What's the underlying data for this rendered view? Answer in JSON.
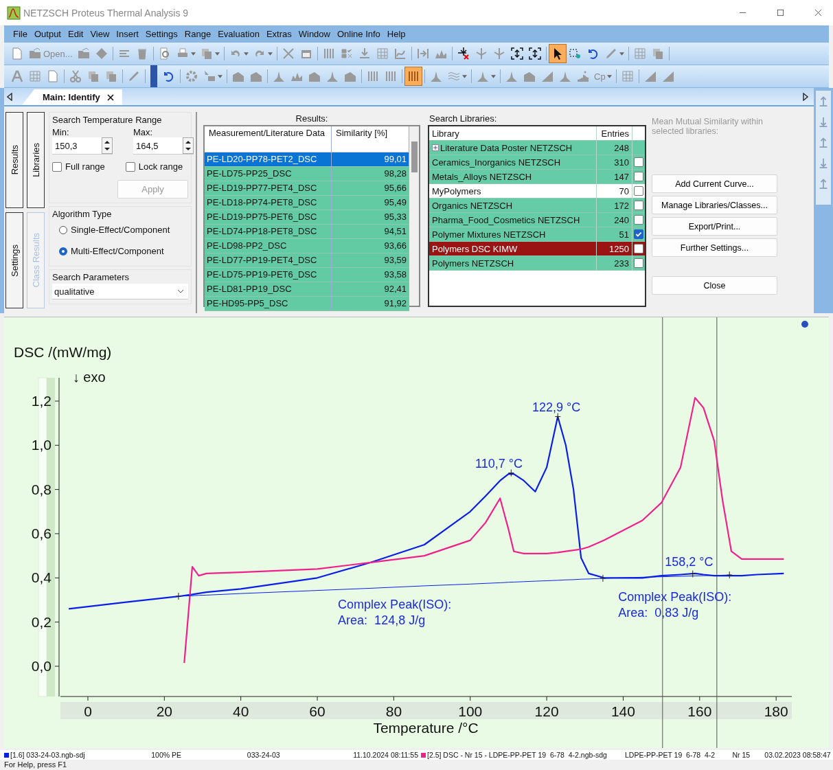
{
  "window": {
    "title": "NETZSCH Proteus Thermal Analysis 9"
  },
  "menu": [
    "File",
    "Output",
    "Edit",
    "View",
    "Insert",
    "Settings",
    "Range",
    "Evaluation",
    "Extras",
    "Window",
    "Online Info",
    "Help"
  ],
  "toolbar_rows": [
    [
      {
        "selected": false
      },
      {
        "label": "Open...",
        "selected": false
      },
      {
        "selected": false
      },
      {
        "selected": false
      },
      {
        "selected": false
      },
      {
        "selected": false
      },
      {
        "selected": false
      },
      {
        "selected": false,
        "dropdown": true
      },
      {
        "selected": false,
        "dropdown": true
      },
      {
        "selected": false,
        "dropdown": true
      },
      {
        "selected": false,
        "dropdown": true
      },
      {
        "selected": false
      },
      {
        "selected": false
      },
      {
        "selected": false
      },
      {
        "selected": false
      },
      {
        "selected": false
      },
      {
        "selected": false
      },
      {
        "selected": false
      },
      {
        "selected": false
      },
      {
        "selected": false
      },
      {
        "selected": false
      },
      {
        "selected": false
      },
      {
        "selected": false
      },
      {
        "selected": false
      },
      {
        "selected": false
      },
      {
        "selected": true
      },
      {
        "selected": false
      },
      {
        "selected": false
      },
      {
        "selected": false,
        "dropdown": true
      },
      {
        "selected": false
      },
      {
        "selected": false
      }
    ],
    [
      {
        "selected": false
      },
      {
        "selected": false
      },
      {
        "selected": false
      },
      {
        "selected": false
      },
      {
        "selected": false
      },
      {
        "selected": false
      },
      {
        "selected": false
      },
      {
        "selected": false
      },
      {
        "selected": false
      },
      {
        "selected": false,
        "dropdown": true
      },
      {
        "selected": false
      },
      {
        "selected": false
      },
      {
        "selected": false
      },
      {
        "selected": false
      },
      {
        "selected": false
      },
      {
        "selected": false
      },
      {
        "selected": false
      },
      {
        "selected": false
      },
      {
        "selected": false
      },
      {
        "selected": true
      },
      {
        "selected": false
      },
      {
        "selected": false,
        "dropdown": true
      },
      {
        "selected": false,
        "dropdown": true
      },
      {
        "selected": false
      },
      {
        "selected": false
      },
      {
        "selected": false
      },
      {
        "selected": false
      },
      {
        "selected": false
      },
      {
        "label": "Cp",
        "selected": false,
        "dropdown": true
      },
      {
        "selected": false
      },
      {
        "selected": false
      },
      {
        "selected": false
      }
    ]
  ],
  "document_tabs": [
    {
      "label": "Main: Identify",
      "selected": true
    }
  ],
  "side_tabs": [
    {
      "label": "Results",
      "disabled": false
    },
    {
      "label": "Libraries",
      "disabled": false
    },
    {
      "label": "Settings",
      "disabled": false
    },
    {
      "label": "Class Results",
      "disabled": true
    }
  ],
  "temperature_range": {
    "title": "Search Temperature Range",
    "min_label": "Min:",
    "min": "150,3",
    "max_label": "Max:",
    "max": "164,5",
    "full_range": {
      "label": "Full range",
      "checked": false
    },
    "lock_range": {
      "label": "Lock range",
      "checked": false
    },
    "apply": {
      "label": "Apply",
      "disabled": true
    }
  },
  "algorithm": {
    "title": "Algorithm Type",
    "options": [
      {
        "label": "Single-Effect/Component",
        "selected": false
      },
      {
        "label": "Multi-Effect/Component",
        "selected": true
      }
    ]
  },
  "search_parameters": {
    "title": "Search Parameters",
    "value": "qualitative"
  },
  "results": {
    "title": "Results:",
    "columns": [
      "Measurement/Literature Data",
      "Similarity [%]"
    ],
    "rows": [
      {
        "name": "PE-LD20-PP78-PET2_DSC",
        "similarity": "99,01",
        "selected": true
      },
      {
        "name": "PE-LD75-PP25_DSC",
        "similarity": "98,28",
        "selected": false
      },
      {
        "name": "PE-LD19-PP77-PET4_DSC",
        "similarity": "95,66",
        "selected": false
      },
      {
        "name": "PE-LD18-PP74-PET8_DSC",
        "similarity": "95,49",
        "selected": false
      },
      {
        "name": "PE-LD19-PP75-PET6_DSC",
        "similarity": "95,33",
        "selected": false
      },
      {
        "name": "PE-LD74-PP18-PET8_DSC",
        "similarity": "94,51",
        "selected": false
      },
      {
        "name": "PE-LD98-PP2_DSC",
        "similarity": "93,66",
        "selected": false
      },
      {
        "name": "PE-LD77-PP19-PET4_DSC",
        "similarity": "93,59",
        "selected": false
      },
      {
        "name": "PE-LD75-PP19-PET6_DSC",
        "similarity": "93,58",
        "selected": false
      },
      {
        "name": "PE-LD81-PP19_DSC",
        "similarity": "92,41",
        "selected": false
      },
      {
        "name": "PE-HD95-PP5_DSC",
        "similarity": "91,92",
        "selected": false
      }
    ]
  },
  "libraries": {
    "title": "Search Libraries:",
    "columns": [
      "Library",
      "Entries"
    ],
    "rows": [
      {
        "kind": "group",
        "name": "Literature Data Poster NETZSCH",
        "entries": "248",
        "color": "#66cca8",
        "selected": false,
        "expanded": false
      },
      {
        "kind": "library",
        "name": "Ceramics_Inorganics NETZSCH",
        "entries": "310",
        "color": "#66cca8",
        "selected": false,
        "checked": false
      },
      {
        "kind": "library",
        "name": "Metals_Alloys NETZSCH",
        "entries": "147",
        "color": "#66cca8",
        "selected": false,
        "checked": false
      },
      {
        "kind": "library",
        "name": "MyPolymers",
        "entries": "70",
        "color": "#ffffff",
        "selected": false,
        "checked": false
      },
      {
        "kind": "library",
        "name": "Organics NETZSCH",
        "entries": "172",
        "color": "#66cca8",
        "selected": false,
        "checked": false
      },
      {
        "kind": "library",
        "name": "Pharma_Food_Cosmetics NETZSCH",
        "entries": "240",
        "color": "#66cca8",
        "selected": false,
        "checked": false
      },
      {
        "kind": "library",
        "name": "Polymer Mixtures NETZSCH",
        "entries": "51",
        "color": "#66cca8",
        "selected": false,
        "checked": true
      },
      {
        "kind": "library",
        "name": "Polymers DSC KIMW",
        "entries": "1250",
        "color": "#9b1414",
        "selected": true,
        "checked": false
      },
      {
        "kind": "library",
        "name": "Polymers NETZSCH",
        "entries": "233",
        "color": "#66cca8",
        "selected": false,
        "checked": false
      }
    ]
  },
  "similarity_note": "Mean Mutual Similarity within selected libraries:",
  "buttons": [
    "Add Current Curve...",
    "Manage Libraries/Classes...",
    "Export/Print...",
    "Further Settings..."
  ],
  "close_button": "Close",
  "chart": {
    "chart_data": {
      "type": "line",
      "ylabel": "DSC /(mW/mg)",
      "xlabel": "Temperature /°C",
      "x": [
        -5,
        10,
        24,
        25.2,
        27.3,
        29,
        31,
        40,
        60,
        74,
        88,
        100,
        104,
        107.8,
        110,
        111.4,
        114,
        117,
        120,
        122.9,
        125,
        127,
        129,
        131,
        135,
        145,
        150,
        155,
        158.8,
        161,
        163.8,
        166,
        168.3,
        171,
        175,
        182
      ],
      "series": [
        {
          "color": "#0a1ee6",
          "values": [
            0.26,
            0.29,
            0.317,
            0.32,
            0.325,
            0.33,
            0.335,
            0.35,
            0.4,
            0.47,
            0.55,
            0.7,
            0.77,
            0.84,
            0.87,
            0.87,
            0.84,
            0.79,
            0.9,
            1.13,
            1.0,
            0.8,
            0.49,
            0.42,
            0.4,
            0.4,
            0.41,
            0.415,
            0.42,
            0.415,
            0.41,
            0.41,
            0.41,
            0.41,
            0.415,
            0.42
          ]
        },
        {
          "color": "#f0208c",
          "values": [
            null,
            null,
            null,
            0.015,
            0.45,
            0.41,
            0.42,
            0.425,
            0.44,
            0.47,
            0.5,
            0.57,
            0.65,
            0.76,
            0.62,
            0.52,
            0.51,
            0.51,
            0.51,
            0.515,
            0.52,
            0.525,
            0.53,
            0.54,
            0.57,
            0.66,
            0.74,
            0.9,
            1.215,
            1.17,
            1.02,
            0.75,
            0.52,
            0.485,
            0.485,
            0.485
          ]
        },
        {
          "color": "#0a1ee6",
          "values": [
            null,
            null,
            0.317,
            0.318,
            0.319,
            0.321,
            0.322,
            0.329,
            0.343,
            0.353,
            0.364,
            0.372,
            0.375,
            0.378,
            0.38,
            0.381,
            0.383,
            0.385,
            0.387,
            0.389,
            0.391,
            0.392,
            0.394,
            0.395,
            0.398,
            0.403,
            0.405,
            0.407,
            0.409,
            0.41,
            0.411,
            0.412,
            0.413,
            null,
            null,
            null
          ]
        }
      ],
      "xlim": [
        -7,
        185
      ],
      "ylim": [
        -0.14,
        1.58
      ],
      "xticks": [
        {
          "value": 0,
          "label": "0"
        },
        {
          "value": 20,
          "label": "20"
        },
        {
          "value": 40,
          "label": "40"
        },
        {
          "value": 60,
          "label": "60"
        },
        {
          "value": 80,
          "label": "80"
        },
        {
          "value": 100,
          "label": "100"
        },
        {
          "value": 120,
          "label": "120"
        },
        {
          "value": 140,
          "label": "140"
        },
        {
          "value": 160,
          "label": "160"
        },
        {
          "value": 180,
          "label": "180"
        }
      ],
      "yticks": [
        {
          "value": 0,
          "label": "0,0"
        },
        {
          "value": 0.2,
          "label": "0,2"
        },
        {
          "value": 0.4,
          "label": "0,4"
        },
        {
          "value": 0.6,
          "label": "0,6"
        },
        {
          "value": 0.8,
          "label": "0,8"
        },
        {
          "value": 1.0,
          "label": "1,0"
        },
        {
          "value": 1.2,
          "label": "1,2"
        }
      ],
      "ref_lines": [
        {
          "axis": "x",
          "value": 150.3
        },
        {
          "axis": "x",
          "value": 164.5
        }
      ],
      "annotations": [
        "↓ exo",
        "122,9 °C",
        "110,7 °C",
        "158,2 °C",
        "Complex Peak(ISO):",
        "Area:  124,8 J/g",
        "Complex Peak(ISO):",
        "Area:  0,83 J/g"
      ]
    }
  },
  "status_bar": {
    "segments": [
      {
        "text": "[1.6] 033-24-03.ngb-sdj",
        "color": "#0a1ee6"
      },
      {
        "text": "100% PE"
      },
      {
        "text": "033-24-03"
      },
      {
        "text": "11.10.2024 08:11:55"
      },
      {
        "text": "[2.5] DSC - Nr 15 - LDPE-PP-PET 19  6-78  4-2.ngb-sdg",
        "color": "#f0208c"
      },
      {
        "text": "LDPE-PP-PET 19  6-78  4-2"
      },
      {
        "text": "Nr 15"
      },
      {
        "text": "03.02.2023 08:58:47"
      }
    ],
    "help": "For Help, press F1"
  }
}
